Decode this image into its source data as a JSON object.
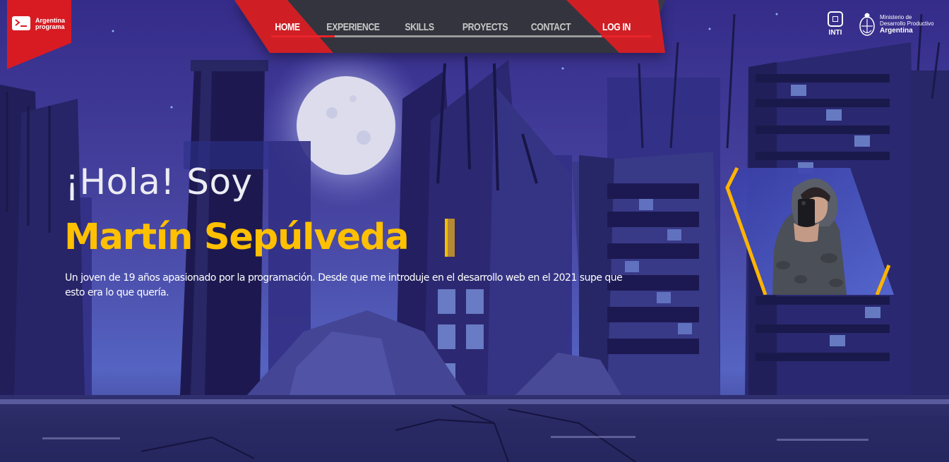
{
  "brand": {
    "logo_line1": "Argentina",
    "logo_line2": "programa",
    "icon": "terminal-prompt-icon",
    "color": "#d81b23"
  },
  "nav": {
    "items": [
      {
        "label": "HOME",
        "active": true
      },
      {
        "label": "EXPERIENCE",
        "active": false
      },
      {
        "label": "SKILLS",
        "active": false
      },
      {
        "label": "PROYECTS",
        "active": false
      },
      {
        "label": "CONTACT",
        "active": false
      }
    ],
    "login_label": "LOG IN",
    "accent": "#e8242a"
  },
  "partners": {
    "inti_label": "INTI",
    "ministerio_line1": "Ministerio de",
    "ministerio_line2": "Desarrollo Productivo",
    "ministerio_line3": "Argentina"
  },
  "hero": {
    "greeting": "¡Hola! Soy",
    "name": "Martín Sepúlveda",
    "description": "Un joven de 19 años apasionado por la programación. Desde que me introduje en el desarrollo web en el 2021 supe que esto era lo que quería.",
    "name_color": "#ffc000"
  }
}
